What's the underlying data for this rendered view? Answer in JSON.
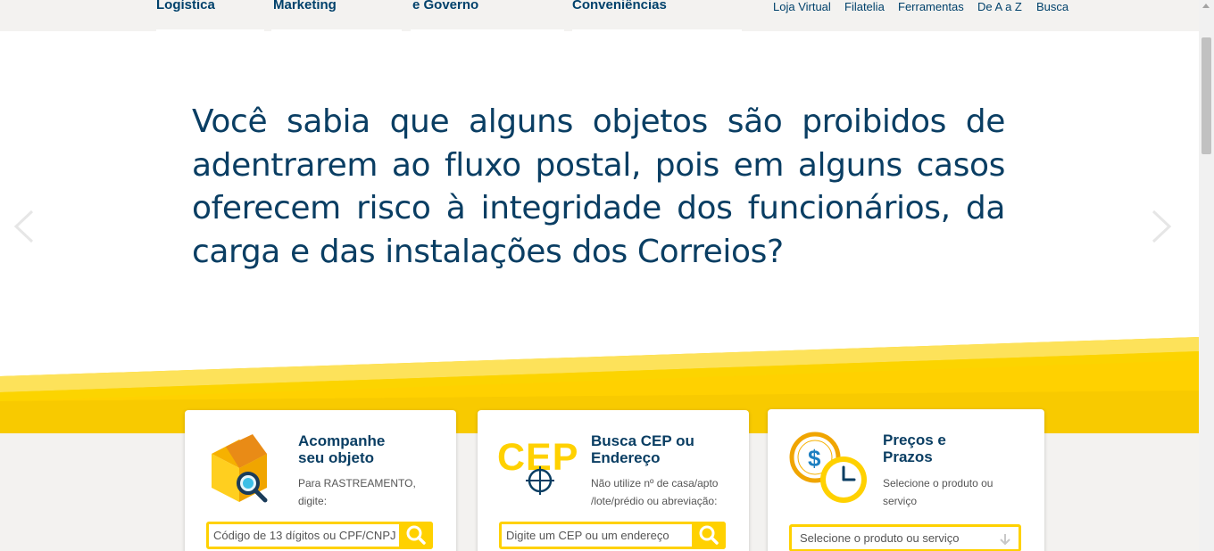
{
  "nav": {
    "primary": [
      "Logística",
      "Marketing",
      "e Governo",
      "Conveniências"
    ],
    "secondary": [
      "Loja Virtual",
      "Filatelia",
      "Ferramentas",
      "De A a Z",
      "Busca"
    ]
  },
  "hero": {
    "text": "Você sabia que alguns objetos são proibidos de adentrarem ao fluxo postal, pois em alguns casos oferecem risco à integridade dos funcionários, da carga e das instalações dos Correios?"
  },
  "cards": {
    "tracking": {
      "title_line1": "Acompanhe",
      "title_line2": "seu objeto",
      "desc_line1": "Para RASTREAMENTO,",
      "desc_line2": "digite:",
      "placeholder": "Código de 13 dígitos ou CPF/CNPJ",
      "icon": "box-search-icon"
    },
    "cep": {
      "title_line1": "Busca CEP ou",
      "title_line2": "Endereço",
      "desc_line1": "Não utilize nº de casa/apto",
      "desc_line2": "/lote/prédio ou abreviação:",
      "placeholder": "Digite um CEP ou um endereço",
      "logo_text": "CEP",
      "icon": "cep-target-icon"
    },
    "prices": {
      "title_line1": "Preços e",
      "title_line2": "Prazos",
      "desc_line1": "Selecione o produto ou",
      "desc_line2": "serviço",
      "select_value": "Selecione o produto ou serviço",
      "icon": "money-clock-icon"
    }
  },
  "colors": {
    "brand_blue": "#0a3e63",
    "brand_yellow": "#ffd100"
  }
}
